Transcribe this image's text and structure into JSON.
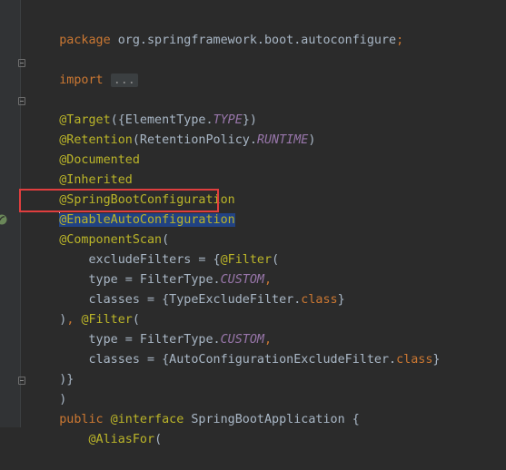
{
  "code": {
    "line1": {
      "kw": "package",
      "txt": " org.springframework.boot.autoconfigure",
      "semi": ";"
    },
    "line2": {
      "kw": "import",
      "fold": "..."
    },
    "line3": {
      "ann": "@Target",
      "t1": "({ElementType.",
      "ital": "TYPE",
      "t2": "})"
    },
    "line4": {
      "ann": "@Retention",
      "t1": "(RetentionPolicy.",
      "ital": "RUNTIME",
      "t2": ")"
    },
    "line5": {
      "ann": "@Documented"
    },
    "line6": {
      "ann": "@Inherited"
    },
    "line7": {
      "ann": "@SpringBootConfiguration"
    },
    "line8": {
      "ann": "@EnableAutoConfiguration"
    },
    "line9": {
      "ann": "@ComponentScan",
      "t1": "("
    },
    "line10": {
      "t1": "    excludeFilters = {",
      "ann": "@Filter",
      "t2": "("
    },
    "line11": {
      "t1": "    type = FilterType.",
      "ital": "CUSTOM",
      "comma": ","
    },
    "line12": {
      "t1": "    classes = {TypeExcludeFilter.",
      "kw": "class",
      "t2": "}"
    },
    "line13": {
      "t1": ")",
      "comma": ", ",
      "ann": "@Filter",
      "t2": "("
    },
    "line14": {
      "t1": "    type = FilterType.",
      "ital": "CUSTOM",
      "comma": ","
    },
    "line15": {
      "t1": "    classes = {AutoConfigurationExcludeFilter.",
      "kw": "class",
      "t2": "}"
    },
    "line16": {
      "t1": ")}"
    },
    "line17": {
      "t1": ")"
    },
    "line18": {
      "kw": "public",
      "ann": " @interface",
      "t1": " SpringBootApplication {"
    },
    "line19": {
      "ann": "    @AliasFor",
      "t1": "("
    }
  },
  "colors": {
    "background": "#2b2b2b",
    "keyword": "#cc7832",
    "text": "#a9b7c6",
    "annotation": "#bbb529",
    "constant": "#9876aa",
    "highlight_box": "#e03e3e",
    "selection": "#214283"
  },
  "icons": {
    "gutter": "spring-bean-icon"
  }
}
